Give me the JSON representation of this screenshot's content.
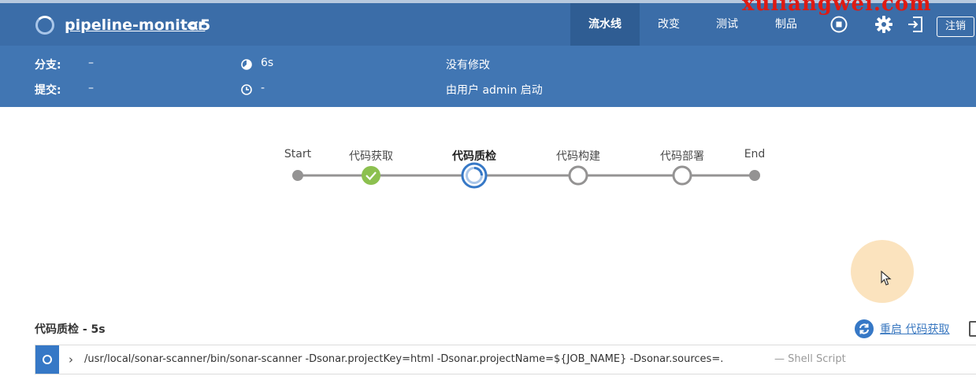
{
  "header": {
    "pipeline_name": "pipeline-monitor",
    "chevron": "<",
    "run_number": "5",
    "tabs": [
      {
        "label": "流水线",
        "active": true
      },
      {
        "label": "改变",
        "active": false
      },
      {
        "label": "测试",
        "active": false
      },
      {
        "label": "制品",
        "active": false
      }
    ],
    "icons": [
      "stop-icon",
      "gear-icon",
      "exit-icon"
    ],
    "logout_label": "注销",
    "watermark": "xuliangwei.com"
  },
  "info": {
    "branch_label": "分支:",
    "branch_value": "–",
    "commit_label": "提交:",
    "commit_value": "–",
    "duration": "6s",
    "started": "-",
    "changes": "没有修改",
    "trigger": "由用户 admin 启动"
  },
  "pipeline": {
    "stages": [
      {
        "label": "Start",
        "status": "start"
      },
      {
        "label": "代码获取",
        "status": "success"
      },
      {
        "label": "代码质检",
        "status": "running"
      },
      {
        "label": "代码构建",
        "status": "pending"
      },
      {
        "label": "代码部署",
        "status": "pending"
      },
      {
        "label": "End",
        "status": "end"
      }
    ],
    "colors": {
      "success": "#8cc04f",
      "running": "#3678c6",
      "line": "#949393"
    }
  },
  "step": {
    "title": "代码质检 - 5s",
    "restart_label": "重启 代码获取",
    "log": {
      "command": "/usr/local/sonar-scanner/bin/sonar-scanner -Dsonar.projectKey=html -Dsonar.projectName=${JOB_NAME} -Dsonar.sources=.",
      "type": "— Shell Script"
    }
  }
}
